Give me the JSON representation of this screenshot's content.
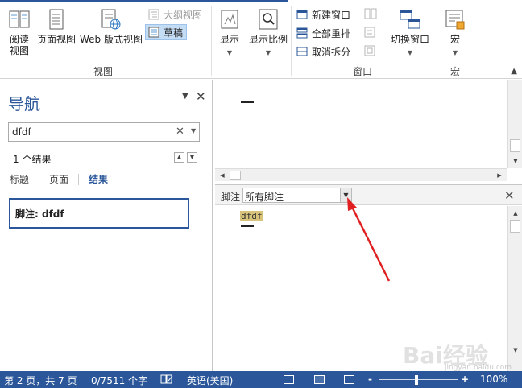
{
  "ribbon": {
    "read_mode_label": "阅读\n视图",
    "read_mode_line1": "阅读",
    "read_mode_line2": "视图",
    "print_layout_label": "页面视图",
    "web_layout_label": "Web 版式视图",
    "outline_label": "大纲视图",
    "draft_label": "草稿",
    "views_group": "视图",
    "show_label": "显示",
    "zoom_label": "显示比例",
    "new_window_label": "新建窗口",
    "arrange_all_label": "全部重排",
    "unsplit_label": "取消拆分",
    "switch_window_label": "切换窗口",
    "window_group": "窗口",
    "macros_label": "宏",
    "macros_group": "宏"
  },
  "nav_pane": {
    "title": "导航",
    "search_value": "dfdf",
    "result_count": "1 个结果",
    "tabs": [
      "标题",
      "页面",
      "结果"
    ],
    "active_tab": "结果",
    "result_item": "脚注: dfdf"
  },
  "footnote_pane": {
    "label": "脚注",
    "selected_option": "所有脚注",
    "footnote_text": "dfdf"
  },
  "status_bar": {
    "page": "第 2 页，共 7 页",
    "words": "0/7511 个字",
    "language": "英语(美国)",
    "zoom_minus": "-",
    "zoom_plus": "+",
    "zoom_value": "100%"
  },
  "watermark": {
    "text": "Bai经验",
    "sub": "jingyan.baidu.com"
  },
  "colors": {
    "accent": "#2b579a",
    "annotation_arrow": "#e02020",
    "footnote_highlight": "#d8c37a"
  }
}
